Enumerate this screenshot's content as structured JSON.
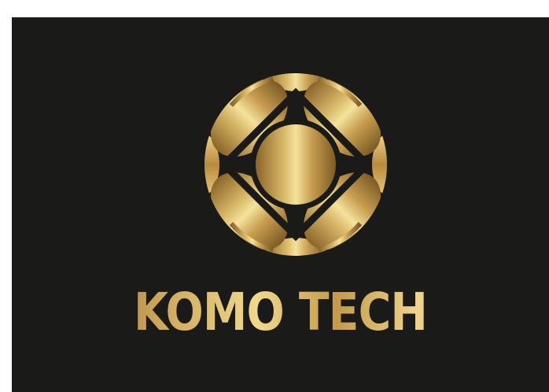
{
  "brand": {
    "name": "KOMO TECH",
    "logo_icon": "geometric-flower-emblem-icon"
  },
  "colors": {
    "background": "#1a1a18",
    "gold_dark": "#8a6428",
    "gold_mid": "#c9a255",
    "gold_light": "#f0d98c"
  }
}
